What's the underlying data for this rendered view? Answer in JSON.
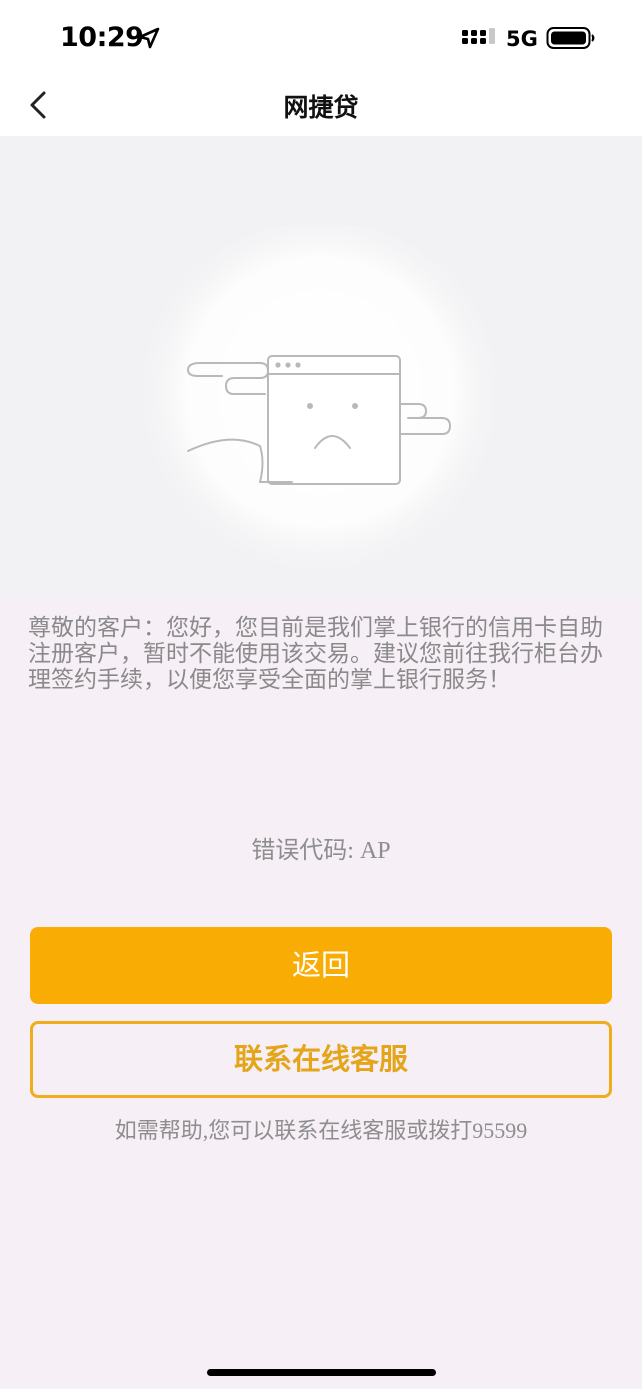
{
  "status_bar": {
    "time": "10:29",
    "network": "5G"
  },
  "nav": {
    "title": "网捷贷"
  },
  "message": "尊敬的客户：您好，您目前是我们掌上银行的信用卡自助注册客户，暂时不能使用该交易。建议您前往我行柜台办理签约手续，以便您享受全面的掌上银行服务！",
  "error_code": "错误代码: AP",
  "buttons": {
    "return_label": "返回",
    "service_label": "联系在线客服"
  },
  "help_text": "如需帮助,您可以联系在线客服或拨打95599",
  "colors": {
    "accent": "#f9ad04",
    "accent_border": "#f0ad1b",
    "page_bg": "#f6eff6"
  },
  "icons": [
    "location-arrow-icon",
    "signal-icon",
    "battery-icon",
    "back-chevron-icon",
    "sad-window-icon"
  ]
}
